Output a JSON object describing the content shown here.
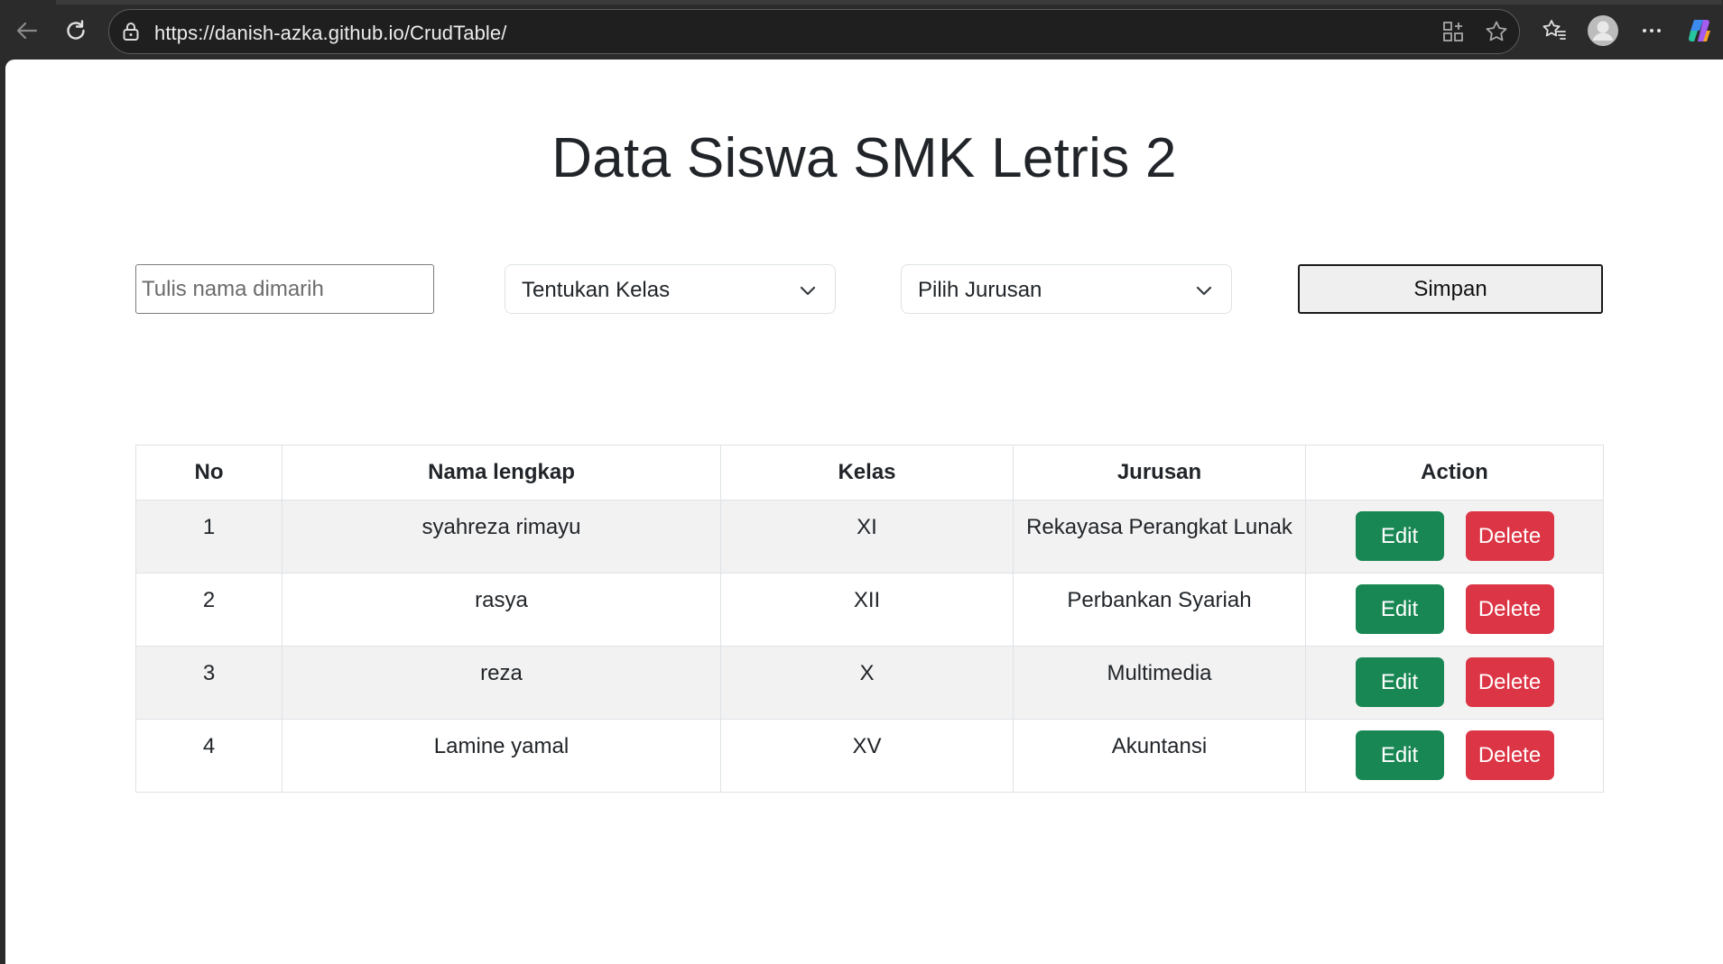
{
  "browser": {
    "url": "https://danish-azka.github.io/CrudTable/"
  },
  "page": {
    "title": "Data Siswa SMK Letris 2",
    "form": {
      "name_placeholder": "Tulis nama dimarih",
      "name_value": "",
      "kelas_select": "Tentukan Kelas",
      "jurusan_select": "Pilih Jurusan",
      "save_label": "Simpan"
    },
    "table": {
      "headers": [
        "No",
        "Nama lengkap",
        "Kelas",
        "Jurusan",
        "Action"
      ],
      "rows": [
        {
          "no": "1",
          "nama": "syahreza rimayu",
          "kelas": "XI",
          "jurusan": "Rekayasa Perangkat Lunak"
        },
        {
          "no": "2",
          "nama": "rasya",
          "kelas": "XII",
          "jurusan": "Perbankan Syariah"
        },
        {
          "no": "3",
          "nama": "reza",
          "kelas": "X",
          "jurusan": "Multimedia"
        },
        {
          "no": "4",
          "nama": "Lamine yamal",
          "kelas": "XV",
          "jurusan": "Akuntansi"
        }
      ],
      "edit_label": "Edit",
      "delete_label": "Delete"
    }
  },
  "colors": {
    "edit": "#198754",
    "delete": "#dc3545",
    "stripe": "#f2f2f2",
    "chrome": "#2b2b2b"
  },
  "icons": [
    "back-arrow-icon",
    "refresh-icon",
    "lock-icon",
    "add-app-icon",
    "favorite-star-icon",
    "favorites-icon",
    "profile-icon",
    "more-icon",
    "copilot-icon",
    "chevron-down-icon"
  ]
}
